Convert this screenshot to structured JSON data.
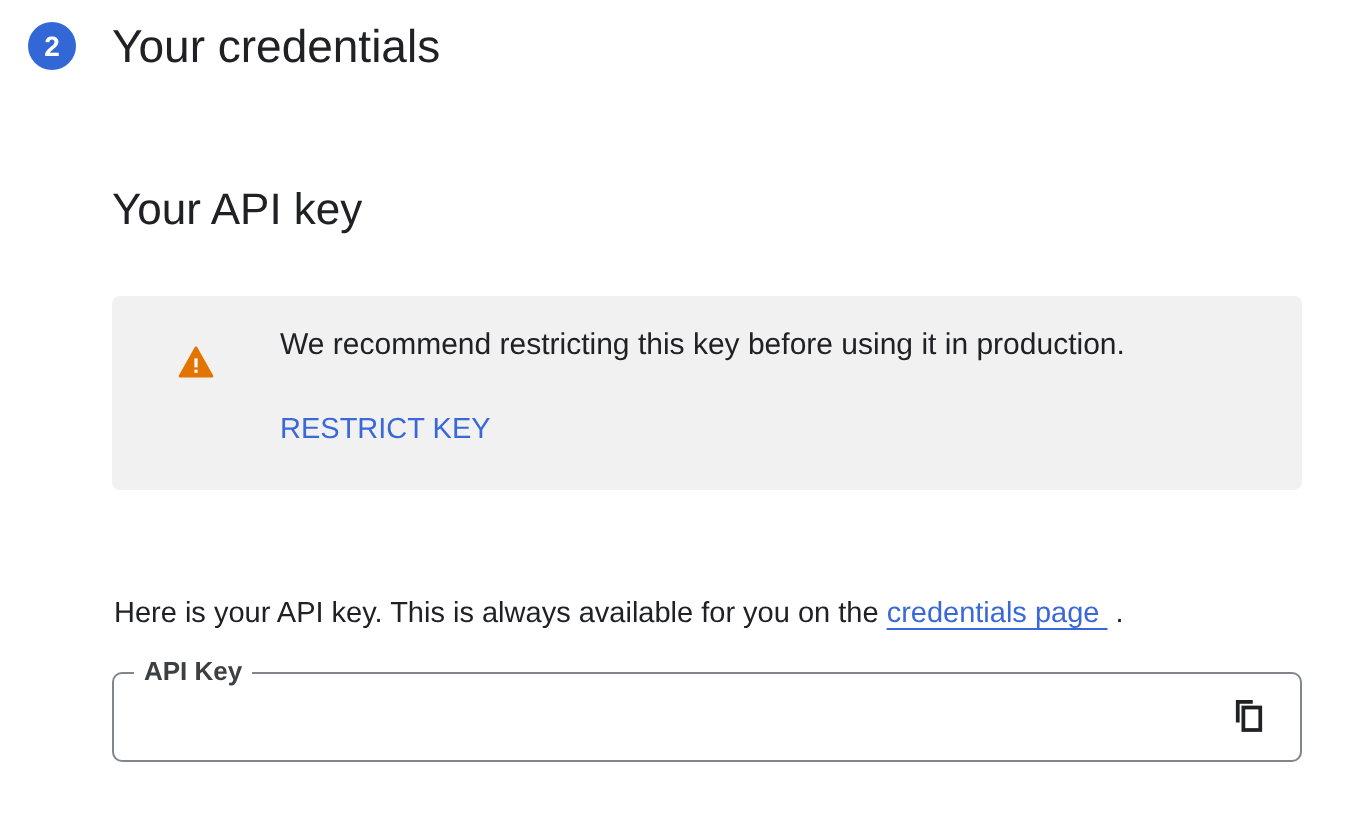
{
  "step": {
    "number": "2",
    "title": "Your credentials"
  },
  "section_title": "Your API key",
  "notice": {
    "kind": "warning",
    "message": "We recommend restricting this key before using it in production.",
    "action": "RESTRICT KEY"
  },
  "info": {
    "text": "Here is your API key. This is always available for you on the",
    "link": "credentials page",
    "after": "."
  },
  "api_key_field": {
    "label": "API Key"
  }
}
